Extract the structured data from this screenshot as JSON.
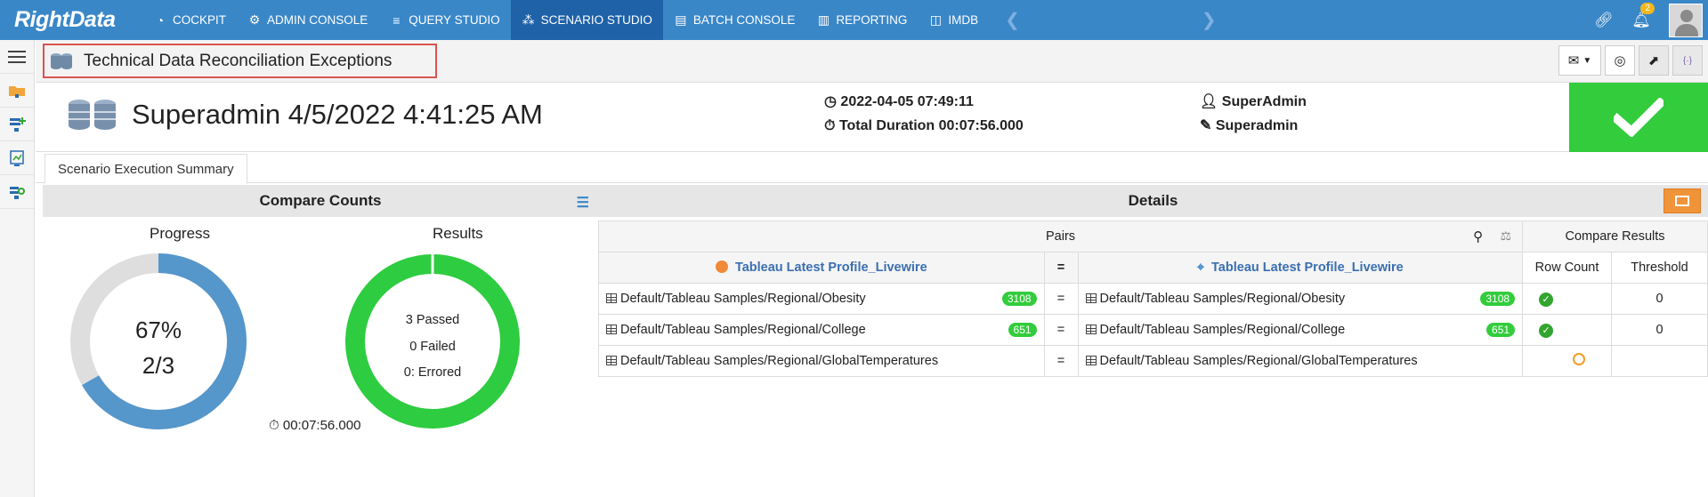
{
  "app": {
    "logo_text": "RightData"
  },
  "nav": {
    "items": [
      {
        "label": "COCKPIT",
        "icon": "cockpit-icon"
      },
      {
        "label": "ADMIN CONSOLE",
        "icon": "gear-icon"
      },
      {
        "label": "QUERY STUDIO",
        "icon": "database-icon"
      },
      {
        "label": "SCENARIO STUDIO",
        "icon": "scenario-icon",
        "active": true
      },
      {
        "label": "BATCH CONSOLE",
        "icon": "batch-icon"
      },
      {
        "label": "REPORTING",
        "icon": "report-icon"
      },
      {
        "label": "IMDB",
        "icon": "imdb-icon"
      }
    ],
    "notifications": "2",
    "accent": "#3a87c8",
    "active_bg": "#1f62a8"
  },
  "page": {
    "title": "Technical Data Reconciliation Exceptions"
  },
  "header": {
    "run_name": "Superadmin 4/5/2022 4:41:25 AM",
    "timestamp": "2022-04-05 07:49:11",
    "duration": "Total Duration 00:07:56.000",
    "user": "SuperAdmin",
    "editor": "Superadmin",
    "status_color": "#33cc3c"
  },
  "tabs": {
    "summary": "Scenario Execution Summary"
  },
  "compare_counts": {
    "title": "Compare Counts",
    "progress": {
      "label": "Progress",
      "percent_text": "67%",
      "count_text": "2/3",
      "fraction": 0.667
    },
    "results": {
      "label": "Results",
      "passed": "3 Passed",
      "failed": "0 Failed",
      "errored": "0: Errored",
      "pass_fraction": 1.0
    },
    "elapsed": "00:07:56.000"
  },
  "details": {
    "title": "Details",
    "pairs_label": "Pairs",
    "compare_results_label": "Compare Results",
    "source_header": "Tableau Latest Profile_Livewire",
    "target_header": "Tableau Latest Profile_Livewire",
    "equals": "=",
    "row_count_label": "Row Count",
    "threshold_label": "Threshold",
    "rows": [
      {
        "source": "Default/Tableau Samples/Regional/Obesity",
        "source_count": "3108",
        "target": "Default/Tableau Samples/Regional/Obesity",
        "target_count": "3108",
        "status": "ok",
        "threshold": "0"
      },
      {
        "source": "Default/Tableau Samples/Regional/College",
        "source_count": "651",
        "target": "Default/Tableau Samples/Regional/College",
        "target_count": "651",
        "status": "ok",
        "threshold": "0"
      },
      {
        "source": "Default/Tableau Samples/Regional/GlobalTemperatures",
        "source_count": "",
        "target": "Default/Tableau Samples/Regional/GlobalTemperatures",
        "target_count": "",
        "status": "running",
        "threshold": ""
      }
    ]
  }
}
